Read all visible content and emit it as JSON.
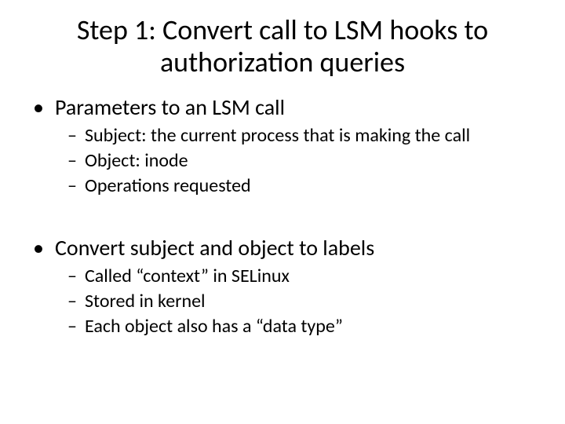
{
  "title": "Step 1: Convert call to LSM hooks to authorization queries",
  "bullets": [
    {
      "text": "Parameters to an LSM call",
      "sub": [
        "Subject: the current process that is making the call",
        "Object: inode",
        "Operations requested"
      ]
    },
    {
      "text": "Convert subject and object to labels",
      "sub": [
        "Called “context” in SELinux",
        "Stored in kernel",
        "Each object also has a “data type”"
      ]
    }
  ]
}
